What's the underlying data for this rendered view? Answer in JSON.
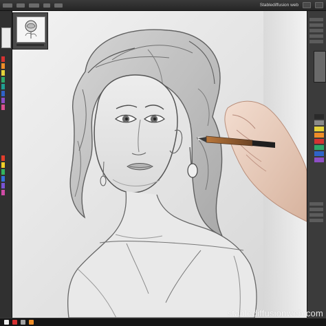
{
  "topbar": {
    "right_label": "Stablediffusion web",
    "items": [
      "menu-1",
      "menu-2",
      "menu-3",
      "menu-4",
      "menu-5"
    ]
  },
  "watermark": {
    "text": "stablediffusionweb.com"
  },
  "colors": {
    "accent_green": "#2ea86a",
    "accent_red": "#d63232",
    "accent_yellow": "#e5d23a",
    "accent_blue": "#2f63c8",
    "accent_orange": "#ef8d28",
    "accent_purple": "#8e4ec6"
  },
  "icons": {
    "navigator_thumb": "rose-thumbnail",
    "pencil_tool": "pencil-icon",
    "hand_drawing": "drawing-hand"
  }
}
